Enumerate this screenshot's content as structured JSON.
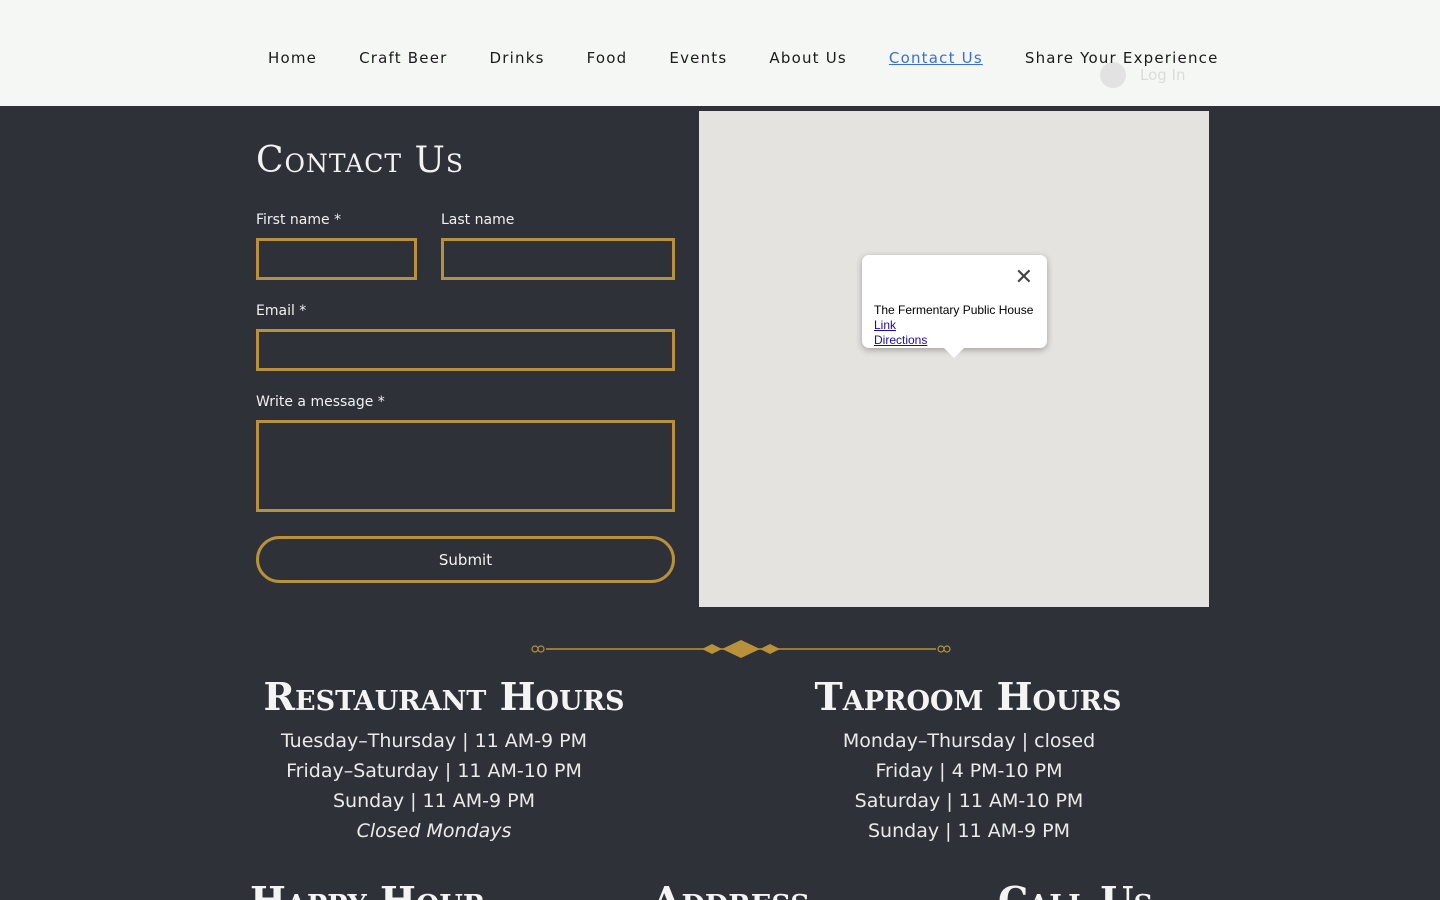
{
  "nav": {
    "items": [
      {
        "label": "Home"
      },
      {
        "label": "Craft Beer"
      },
      {
        "label": "Drinks"
      },
      {
        "label": "Food"
      },
      {
        "label": "Events"
      },
      {
        "label": "About Us"
      },
      {
        "label": "Contact Us",
        "active": true
      },
      {
        "label": "Share Your Experience"
      }
    ],
    "login_label": "Log In"
  },
  "contact": {
    "title": "Contact Us",
    "first_name_label": "First name *",
    "last_name_label": "Last name",
    "email_label": "Email *",
    "message_label": "Write a message *",
    "first_name_value": "",
    "last_name_value": "",
    "email_value": "",
    "message_value": "",
    "submit_label": "Submit"
  },
  "map": {
    "place_name": "The Fermentary Public House",
    "link_label": "Link",
    "directions_label": "Directions",
    "close_icon": "close-icon"
  },
  "restaurant_hours": {
    "title": "Restaurant Hours",
    "lines": [
      "Tuesday–Thursday | 11 AM-9 PM",
      "Friday–Saturday | 11 AM-10 PM",
      "Sunday | 11 AM-9 PM",
      "Closed Mondays"
    ]
  },
  "taproom_hours": {
    "title": "Taproom Hours",
    "lines": [
      "Monday–Thursday | closed",
      "Friday | 4 PM-10 PM",
      "Saturday | 11 AM-10 PM",
      "Sunday | 11 AM-9 PM"
    ]
  },
  "bottom_sections": {
    "happy_hour_title": "Happy Hour",
    "address_title": "Address",
    "call_us_title": "Call Us"
  },
  "colors": {
    "background": "#2e3238",
    "accent_gold": "#b9913a",
    "header_bg": "#f5f7f5",
    "active_link": "#3a6fd8"
  }
}
